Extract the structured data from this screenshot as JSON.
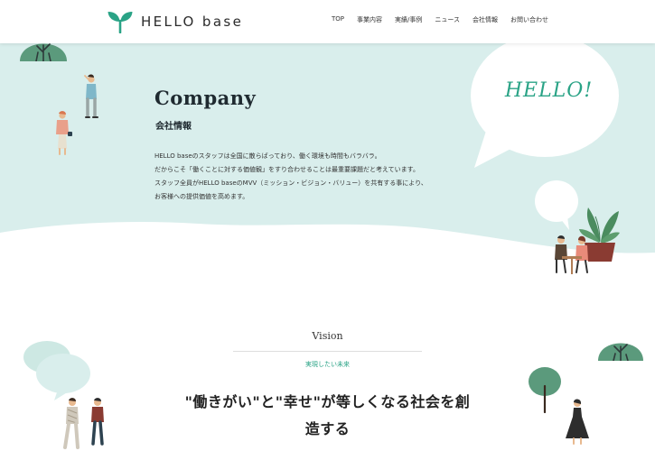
{
  "header": {
    "logo_text": "HELLO base",
    "nav": [
      "TOP",
      "事業内容",
      "実績/事例",
      "ニュース",
      "会社情報",
      "お問い合わせ"
    ]
  },
  "hero": {
    "title_en": "Company",
    "title_ja": "会社情報",
    "intro_lines": [
      "HELLO baseのスタッフは全国に散らばっており、働く環境も時間もバラバラ。",
      "だからこそ「働くことに対する価値観」をすり合わせることは最重要課題だと考えています。",
      "スタッフ全員がHELLO baseのMVV（ミッション・ビジョン・バリュー）を共有する事により、",
      "お客様への提供価値を高めます。"
    ],
    "bubble_text": "HELLO!"
  },
  "vision": {
    "title": "Vision",
    "subtitle": "実現したい未来",
    "statement_lines": [
      "\"働きがい\"と\"幸せ\"が等しくなる社会を創",
      "造する"
    ]
  },
  "colors": {
    "brand_green": "#2aa386",
    "hero_bg": "#d9eeec",
    "tree_green": "#5b9a7c",
    "plant_green": "#4b8c5f",
    "pot_brown": "#8a3b32"
  },
  "icons": [
    "sprout-logo-icon"
  ]
}
